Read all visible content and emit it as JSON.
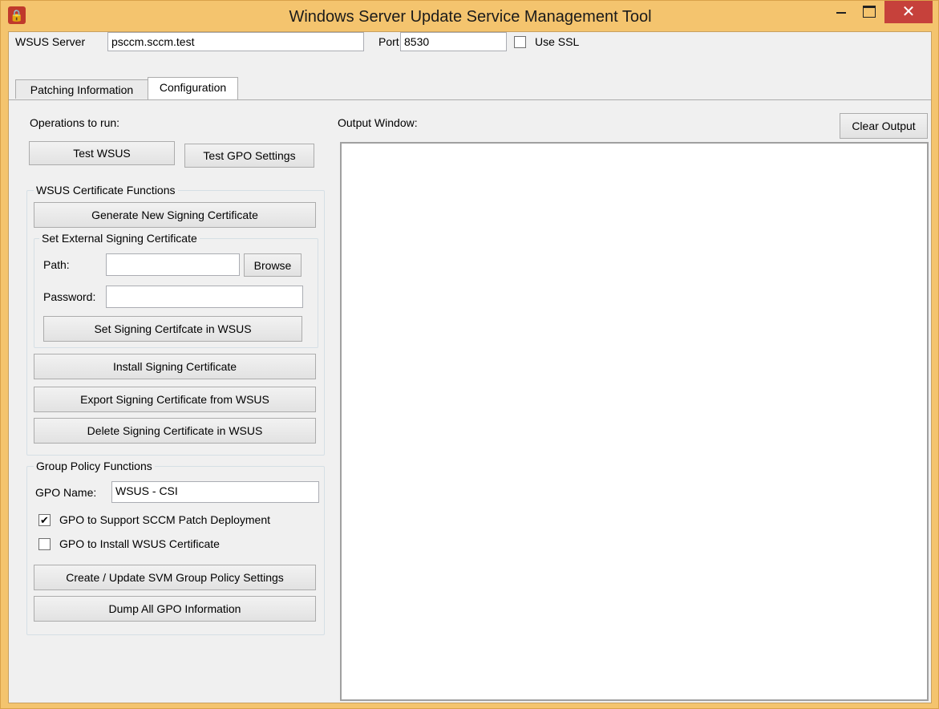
{
  "window": {
    "title": "Windows Server Update Service Management Tool",
    "close_glyph": "✕",
    "icon_glyph": "🔒"
  },
  "server_bar": {
    "wsus_server_label": "WSUS Server",
    "wsus_server_value": "psccm.sccm.test",
    "port_label": "Port",
    "port_value": "8530",
    "use_ssl_label": "Use SSL",
    "use_ssl_checked": false
  },
  "tabs": [
    {
      "label": "Patching Information",
      "active": false
    },
    {
      "label": "Configuration",
      "active": true
    }
  ],
  "operations": {
    "label": "Operations to run:",
    "test_wsus": "Test WSUS",
    "test_gpo": "Test GPO Settings"
  },
  "cert_group": {
    "title": "WSUS Certificate Functions",
    "generate": "Generate New Signing Certificate",
    "external": {
      "title": "Set External Signing Certificate",
      "path_label": "Path:",
      "path_value": "",
      "browse": "Browse",
      "password_label": "Password:",
      "password_value": "",
      "set_button": "Set Signing Certifcate in WSUS"
    },
    "install": "Install Signing Certificate",
    "export": "Export Signing Certificate from WSUS",
    "delete": "Delete Signing Certificate in WSUS"
  },
  "gpo_group": {
    "title": "Group Policy Functions",
    "name_label": "GPO Name:",
    "name_value": "WSUS - CSI",
    "chk_sccm_label": "GPO to Support SCCM Patch Deployment",
    "chk_sccm_checked": true,
    "chk_cert_label": "GPO to Install WSUS Certificate",
    "chk_cert_checked": false,
    "create_update": "Create / Update SVM Group Policy Settings",
    "dump": "Dump All GPO Information"
  },
  "output": {
    "label": "Output Window:",
    "clear": "Clear Output",
    "text": ""
  },
  "colors": {
    "titlebar": "#f4c46e",
    "close": "#c6413b",
    "client": "#f0f0f0"
  }
}
